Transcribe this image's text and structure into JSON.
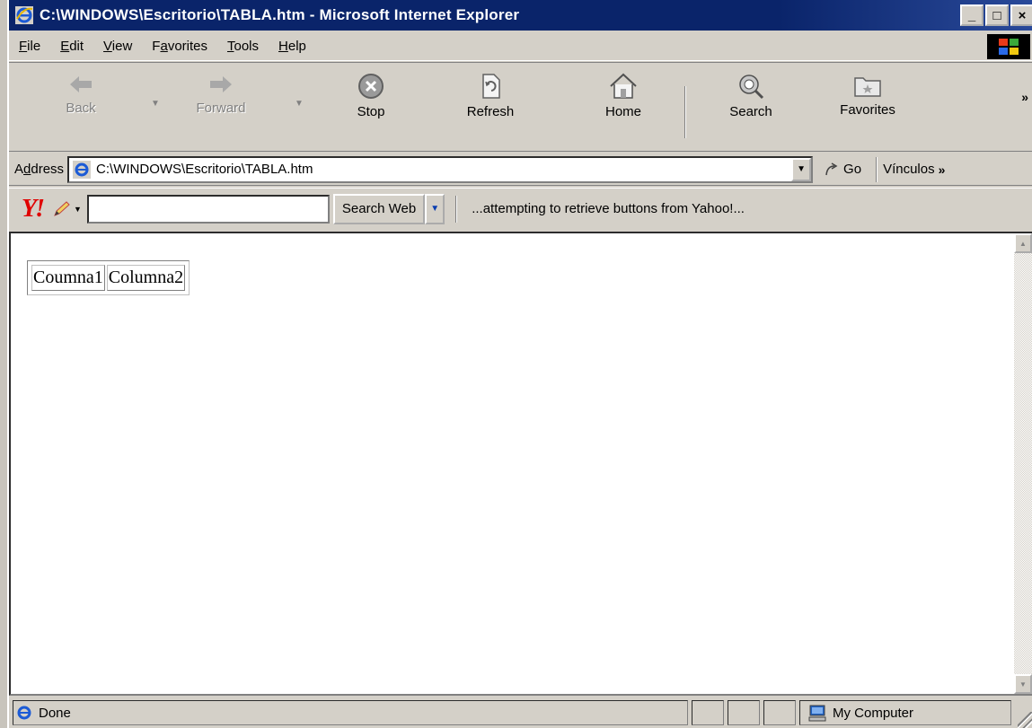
{
  "window": {
    "title": "C:\\WINDOWS\\Escritorio\\TABLA.htm - Microsoft Internet Explorer",
    "minimize": "_",
    "maximize": "□",
    "close": "×"
  },
  "menu": {
    "items": [
      {
        "accel": "F",
        "rest": "ile"
      },
      {
        "accel": "E",
        "rest": "dit"
      },
      {
        "accel": "V",
        "rest": "iew"
      },
      {
        "pre": "F",
        "accel": "a",
        "rest": "vorites"
      },
      {
        "accel": "T",
        "rest": "ools"
      },
      {
        "accel": "H",
        "rest": "elp"
      }
    ]
  },
  "toolbar": {
    "back": "Back",
    "forward": "Forward",
    "stop": "Stop",
    "refresh": "Refresh",
    "home": "Home",
    "search": "Search",
    "favorites": "Favorites",
    "more": "»"
  },
  "address": {
    "label_accel": "d",
    "label_pre": "A",
    "label_rest": "dress",
    "value": "C:\\WINDOWS\\Escritorio\\TABLA.htm",
    "go": "Go",
    "links": "Vínculos",
    "links_more": "»"
  },
  "yahoo": {
    "logo": "Y!",
    "search_value": "",
    "search_button": "Search Web",
    "status": "...attempting to retrieve buttons from Yahoo!..."
  },
  "page": {
    "table": [
      [
        "Coumna1",
        "Columna2"
      ]
    ]
  },
  "status": {
    "text": "Done",
    "zone": "My Computer"
  },
  "colors": {
    "titlebar": "#0a246a",
    "chrome": "#d4d0c8",
    "yahoo_red": "#e00000"
  }
}
